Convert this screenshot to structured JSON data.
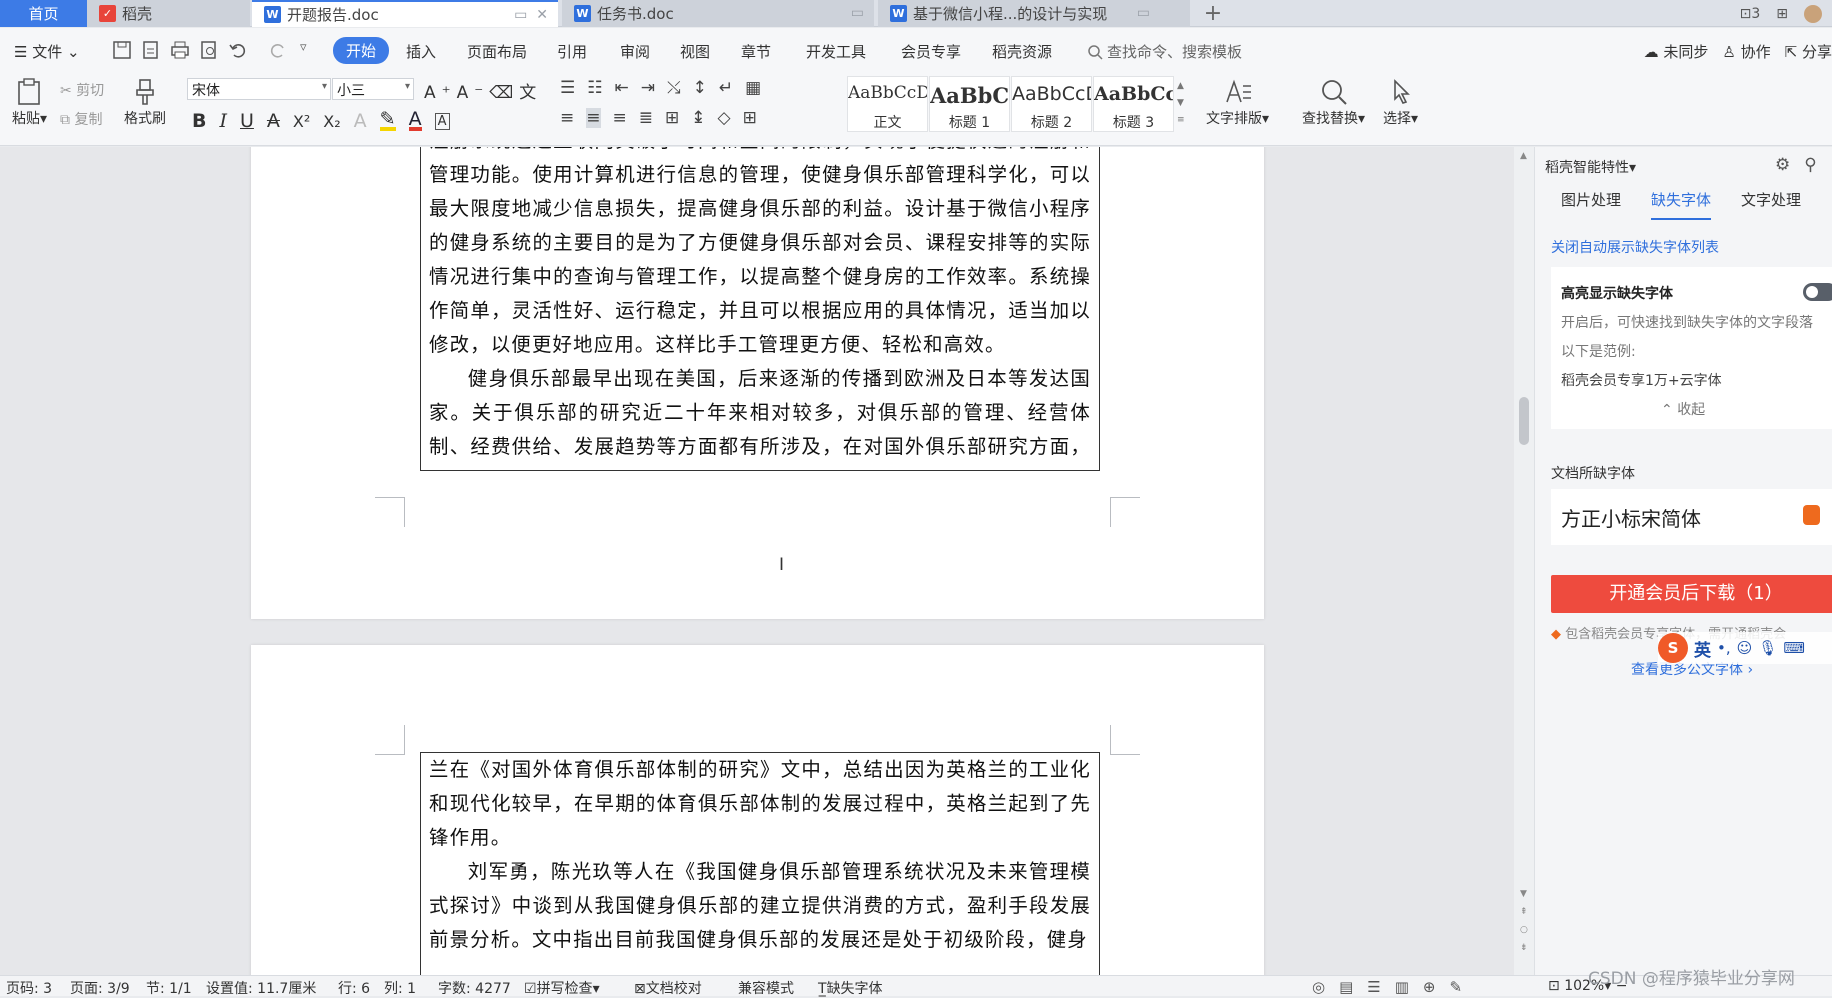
{
  "tabs": {
    "home": "首页",
    "daoke": "稻壳",
    "report": "开题报告.doc",
    "task": "任务书.doc",
    "wechat": "基于微信小程...的设计与实现"
  },
  "menu": {
    "file": "文件",
    "start": "开始",
    "insert": "插入",
    "layout": "页面布局",
    "ref": "引用",
    "review": "审阅",
    "view": "视图",
    "chapter": "章节",
    "dev": "开发工具",
    "member": "会员专享",
    "daoke_res": "稻壳资源",
    "search_placeholder": "查找命令、搜索模板",
    "unsync": "未同步",
    "collab": "协作",
    "share": "分享"
  },
  "ribbon": {
    "paste": "粘贴",
    "cut": "剪切",
    "copy": "复制",
    "format_painter": "格式刷",
    "font_name": "宋体",
    "font_size": "小三",
    "styles": [
      {
        "preview": "AaBbCcDd",
        "label": "正文"
      },
      {
        "preview": "AaBbCc",
        "label": "标题 1"
      },
      {
        "preview": "AaBbCcD",
        "label": "标题 2"
      },
      {
        "preview": "AaBbCcI",
        "label": "标题 3"
      }
    ],
    "text_layout": "文字排版",
    "find_replace": "查找替换",
    "select": "选择"
  },
  "page1": {
    "paragraphs": [
      "注册系统通过互联网突破了时间和空间的限制，实现了便捷快速的注册和管理功能。使用计算机进行信息的管理，使健身俱乐部管理科学化，可以最大限度地减少信息损失，提高健身俱乐部的利益。设计基于微信小程序的健身系统的主要目的是为了方便健身俱乐部对会员、课程安排等的实际情况进行集中的查询与管理工作，以提高整个健身房的工作效率。系统操作简单，灵活性好、运行稳定，并且可以根据应用的具体情况，适当加以修改，以便更好地应用。这样比手工管理更方便、轻松和高效。",
      "健身俱乐部最早出现在美国，后来逐渐的传播到欧洲及日本等发达国家。关于俱乐部的研究近二十年来相对较多，对俱乐部的管理、经营体制、经费供给、发展趋势等方面都有所涉及，在对国外俱乐部研究方面，胡春"
    ]
  },
  "page2": {
    "paragraphs": [
      "兰在《对国外体育俱乐部体制的研究》文中，总结出因为英格兰的工业化和现代化较早，在早期的体育俱乐部体制的发展过程中，英格兰起到了先锋作用。",
      "刘军勇，陈光玖等人在《我国健身俱乐部管理系统状况及未来管理模式探讨》中谈到从我国健身俱乐部的建立提供消费的方式，盈利手段发展前景分析。文中指出目前我国健身俱乐部的发展还是处于初级阶段，健身"
    ]
  },
  "panel": {
    "title": "稻壳智能特性",
    "tabs": [
      "图片处理",
      "缺失字体",
      "文字处理"
    ],
    "close_auto": "关闭自动展示缺失字体列表",
    "highlight_title": "高亮显示缺失字体",
    "highlight_desc": "开启后，可快速找到缺失字体的文字段落",
    "example_label": "以下是范例:",
    "example_value": "稻壳会员专享1万+云字体",
    "collapse": "收起",
    "missing_label": "文档所缺字体",
    "missing_font": "方正小标宋简体",
    "download_btn": "开通会员后下载（1）",
    "note": "包含稻壳会员专享字体，需开通稻壳会",
    "more_link": "查看更多公文字体 ›"
  },
  "ime": {
    "mode": "英"
  },
  "status": {
    "page_no": "页码: 3",
    "pages": "页面: 3/9",
    "section": "节: 1/1",
    "position": "设置值: 11.7厘米",
    "row": "行: 6",
    "col": "列: 1",
    "words": "字数: 4277",
    "spell": "拼写检查",
    "proof": "文档校对",
    "compat": "兼容模式",
    "missing_font": "缺失字体",
    "zoom": "102%"
  },
  "watermark": "CSDN @程序猿毕业分享网",
  "colors": {
    "accent": "#3d7be6",
    "download": "#ee4b3e",
    "panel_link": "#2f6fdc"
  }
}
